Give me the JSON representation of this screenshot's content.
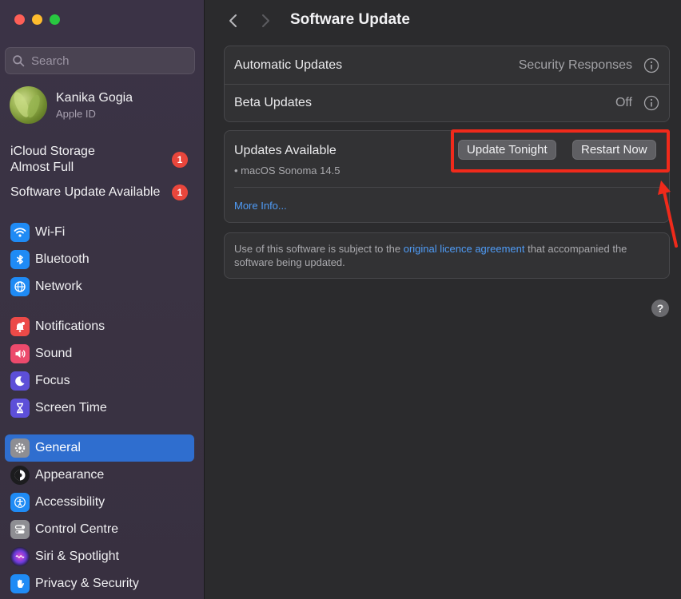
{
  "sidebar": {
    "search_placeholder": "Search",
    "profile": {
      "name": "Kanika Gogia",
      "subtitle": "Apple ID"
    },
    "alerts": [
      {
        "label_line1": "iCloud Storage",
        "label_line2": "Almost Full",
        "badge": "1"
      },
      {
        "label": "Software Update Available",
        "badge": "1"
      }
    ],
    "groups": [
      [
        {
          "label": "Wi-Fi",
          "icon": "wifi-icon",
          "color": "#1f8bf5"
        },
        {
          "label": "Bluetooth",
          "icon": "bluetooth-icon",
          "color": "#1f8bf5"
        },
        {
          "label": "Network",
          "icon": "globe-icon",
          "color": "#1f8bf5"
        }
      ],
      [
        {
          "label": "Notifications",
          "icon": "bell-icon",
          "color": "#ec4a48"
        },
        {
          "label": "Sound",
          "icon": "speaker-icon",
          "color": "#ec4a6c"
        },
        {
          "label": "Focus",
          "icon": "moon-icon",
          "color": "#5d4fd8"
        },
        {
          "label": "Screen Time",
          "icon": "hourglass-icon",
          "color": "#5d4fd8"
        }
      ],
      [
        {
          "label": "General",
          "icon": "gear-icon",
          "color": "#8e8e93",
          "active": true
        },
        {
          "label": "Appearance",
          "icon": "appearance-icon",
          "color": "#1c1c1e"
        },
        {
          "label": "Accessibility",
          "icon": "accessibility-icon",
          "color": "#1f8bf5"
        },
        {
          "label": "Control Centre",
          "icon": "toggles-icon",
          "color": "#8e8e93"
        },
        {
          "label": "Siri & Spotlight",
          "icon": "siri-icon",
          "color": "#2b2b35"
        },
        {
          "label": "Privacy & Security",
          "icon": "hand-icon",
          "color": "#1f8bf5"
        }
      ]
    ]
  },
  "main": {
    "title": "Software Update",
    "settings": [
      {
        "label": "Automatic Updates",
        "value": "Security Responses"
      },
      {
        "label": "Beta Updates",
        "value": "Off"
      }
    ],
    "updates": {
      "title": "Updates Available",
      "item": "• macOS Sonoma 14.5",
      "update_tonight": "Update Tonight",
      "restart_now": "Restart Now",
      "more_info": "More Info..."
    },
    "legal": {
      "prefix": "Use of this software is subject to the ",
      "link": "original licence agreement",
      "suffix": " that accompanied the software being updated."
    },
    "help": "?"
  },
  "annotation": {
    "color": "#f02a1b"
  }
}
